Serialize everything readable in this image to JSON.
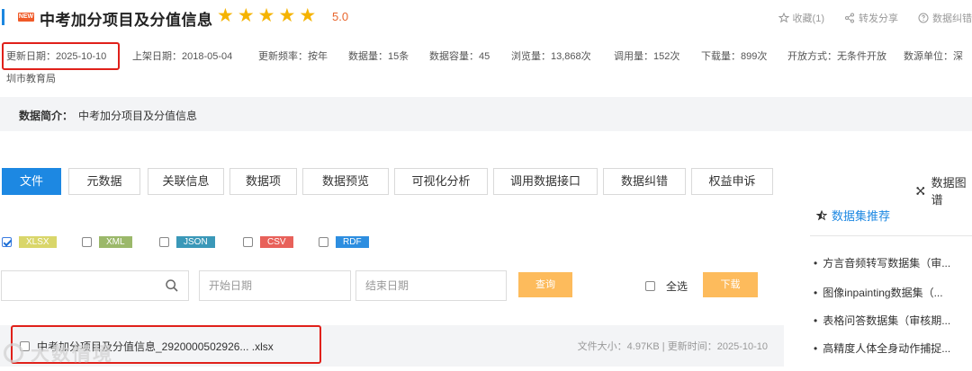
{
  "header": {
    "new_badge": "NEW",
    "title": "中考加分项目及分值信息",
    "rating": 5,
    "score": "5.0",
    "actions": [
      {
        "label": "收藏(1)",
        "icon": "star-outline-icon"
      },
      {
        "label": "转发分享",
        "icon": "share-icon"
      },
      {
        "label": "数据纠错",
        "icon": "question-circle-icon"
      }
    ]
  },
  "meta": {
    "update_date": "更新日期：2025-10-10",
    "list_date": "上架日期：2018-05-04",
    "frequency": "更新频率：按年",
    "data_count": "数据量：15条",
    "capacity": "数据容量：45",
    "views": "浏览量：13,868次",
    "calls": "调用量：152次",
    "downloads": "下载量：899次",
    "open_mode": "开放方式：无条件开放",
    "source_unit": "数源单位：深",
    "source_unit_cont": "圳市教育局"
  },
  "intro": {
    "label": "数据简介：",
    "text": "中考加分项目及分值信息"
  },
  "tabs": [
    "文件",
    "元数据",
    "关联信息",
    "数据项",
    "数据预览",
    "可视化分析",
    "调用数据接口",
    "数据纠错",
    "权益申诉"
  ],
  "map_link": "数据图谱",
  "formats": [
    {
      "label": "XLSX",
      "color": "#d9d66a",
      "checked": true
    },
    {
      "label": "XML",
      "color": "#9bb86a",
      "checked": false
    },
    {
      "label": "JSON",
      "color": "#3a98b8",
      "checked": false
    },
    {
      "label": "CSV",
      "color": "#e8615a",
      "checked": false
    },
    {
      "label": "RDF",
      "color": "#2d8ee0",
      "checked": false
    }
  ],
  "search": {
    "placeholder": "",
    "start_date_placeholder": "开始日期",
    "end_date_placeholder": "结束日期",
    "query_label": "查询",
    "select_all_label": "全选",
    "download_label": "下载"
  },
  "file": {
    "name": "中考加分项目及分值信息_2920000502926... .xlsx",
    "meta": "文件大小：4.97KB | 更新时间：2025-10-10"
  },
  "watermark": "大数情境",
  "sidebar": {
    "title": "数据集推荐",
    "items": [
      "方言音频转写数据集（审...",
      "图像inpainting数据集（...",
      "表格问答数据集（审核期...",
      "高精度人体全身动作捕捉..."
    ]
  }
}
